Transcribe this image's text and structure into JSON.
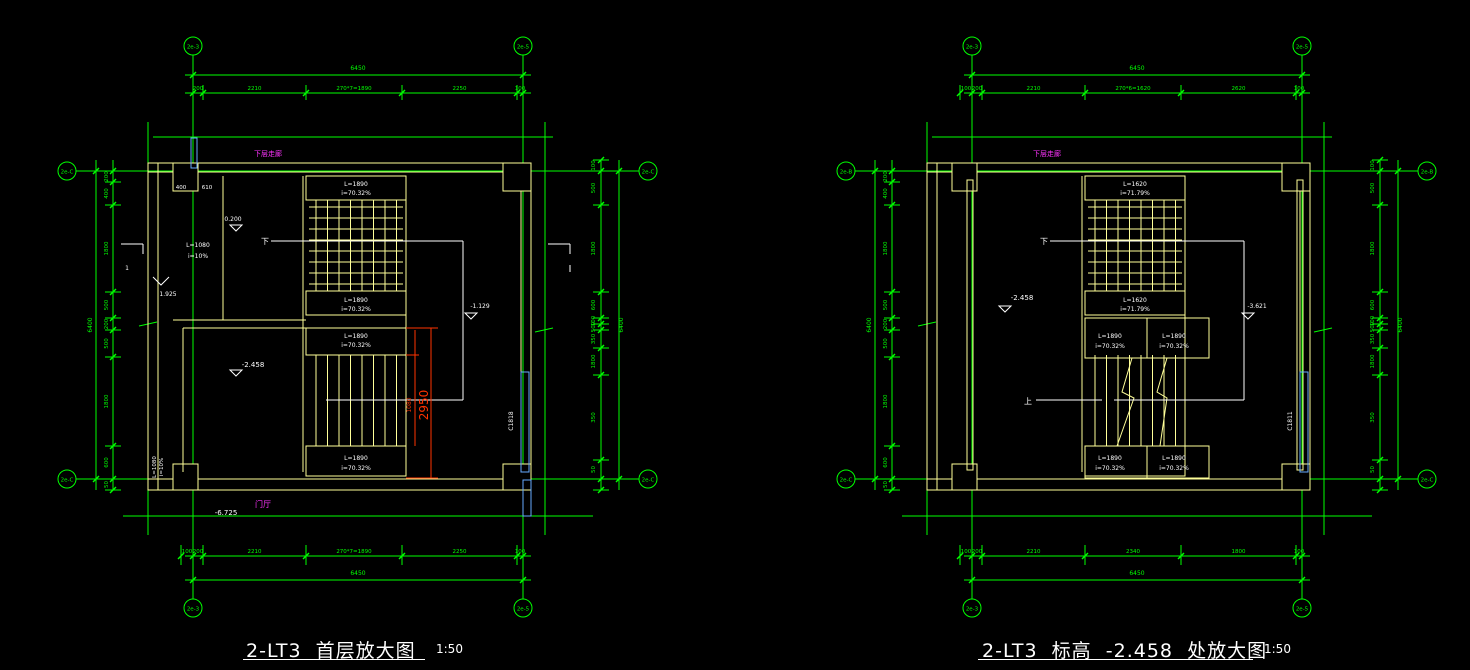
{
  "colors": {
    "dim": "#00ff00",
    "wall": "#ffff99",
    "text": "#ffffff",
    "magenta": "#ff33ff",
    "red": "#ff3300",
    "blue": "#66aaff"
  },
  "drawings": [
    {
      "title": "2-LT3  首层放大图",
      "scale": "1:50",
      "axes": {
        "top_left": "2e-3",
        "top_right": "2e-5",
        "left_top": "2e-C",
        "left_bottom": "2e-C",
        "right_top": "2e-C",
        "right_bottom": "2e-C",
        "bottom_left": "2e-3",
        "bottom_right": "2e-5"
      },
      "top_dims": {
        "overall": "6450",
        "segments": [
          "200",
          "2210",
          "270*7=1890",
          "2250",
          "100"
        ]
      },
      "bottom_dims": {
        "overall": "6450",
        "segments": [
          "100",
          "200",
          "2210",
          "270*7=1890",
          "2250",
          "100"
        ]
      },
      "left_dims": {
        "overall": "6400",
        "segments": [
          "200",
          "400",
          "1800",
          "500",
          "200",
          "500",
          "1800",
          "600",
          "50"
        ]
      },
      "right_dims": {
        "overall": "6400",
        "segments": [
          "100",
          "500",
          "1800",
          "600",
          "100",
          "500",
          "350",
          "1800",
          "350",
          "50"
        ]
      },
      "labels": {
        "corridor": "下层走廊",
        "hall": "门厅",
        "flights": [
          "L=1890",
          "i=70.32%",
          "L=1890",
          "i=70.32%",
          "L=1890",
          "i=70.32%",
          "L=1890",
          "i=70.32%"
        ],
        "ramp": [
          "L=1080",
          "i=10%"
        ],
        "small_ramp": [
          "L=1080",
          "i=10%"
        ],
        "levels": [
          "0.200",
          "1.925",
          "-2.458",
          "-1.129",
          "-6.725"
        ],
        "down": "下",
        "door": "C1818",
        "red_dim": "2950",
        "red_small": "1080",
        "misc": [
          "400",
          "610",
          "1"
        ]
      }
    },
    {
      "title": "2-LT3  标高  -2.458  处放大图",
      "scale": "1:50",
      "axes": {
        "top_left": "2e-3",
        "top_right": "2e-5",
        "left_top": "2e-B",
        "left_bottom": "2e-C",
        "right_top": "2e-B",
        "right_bottom": "2e-C",
        "bottom_left": "2e-3",
        "bottom_right": "2e-5"
      },
      "top_dims": {
        "overall": "6450",
        "segments": [
          "100",
          "200",
          "2210",
          "270*6=1620",
          "2620",
          "100"
        ]
      },
      "bottom_dims": {
        "overall": "6450",
        "segments": [
          "100",
          "200",
          "2210",
          "2340",
          "1800",
          "100"
        ]
      },
      "left_dims": {
        "overall": "6400",
        "segments": [
          "200",
          "400",
          "1800",
          "500",
          "200",
          "500",
          "1800",
          "600",
          "50"
        ]
      },
      "right_dims": {
        "overall": "6400",
        "segments": [
          "100",
          "500",
          "1800",
          "600",
          "100",
          "500",
          "350",
          "1800",
          "350",
          "50"
        ]
      },
      "labels": {
        "corridor": "下层走廊",
        "flights": [
          "L=1620",
          "i=71.79%",
          "L=1620",
          "i=71.79%"
        ],
        "landing_flights": [
          "L=1890",
          "i=70.32%",
          "L=1890",
          "i=70.32%",
          "L=1890",
          "i=70.32%",
          "L=1890",
          "i=70.32%"
        ],
        "levels": [
          "-2.458",
          "-3.621"
        ],
        "down": "下",
        "up": "上",
        "door": "C1811"
      }
    }
  ]
}
